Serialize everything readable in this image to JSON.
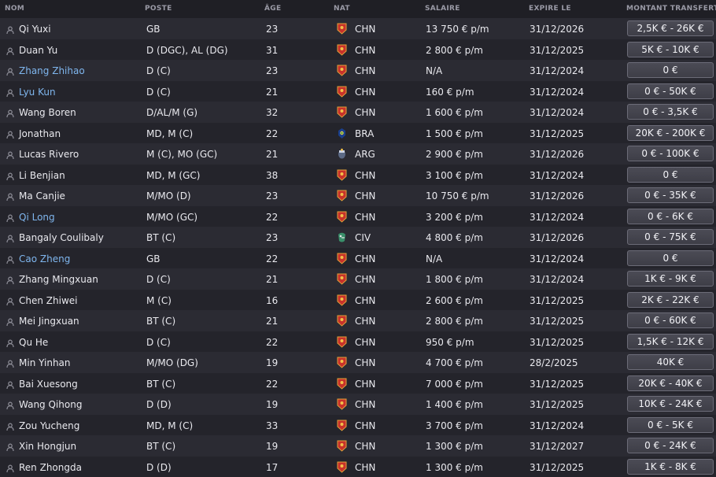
{
  "columns": {
    "name": "NOM",
    "position": "POSTE",
    "age": "ÂGE",
    "nat": "NAT",
    "salary": "SALAIRE",
    "expires": "EXPIRE LE",
    "value": "MONTANT TRANSFERT"
  },
  "colors": {
    "link_name": "#7fb6ee",
    "row_odd": "#2b2b33",
    "row_even": "#24242b",
    "flag_chn": "#c8322a",
    "flag_bra": "#1a3f8c",
    "flag_arg": "#5c6a86",
    "flag_civ": "#3a8f6a"
  },
  "players": [
    {
      "name": "Qi Yuxi",
      "linked": false,
      "position": "GB",
      "age": "23",
      "flag_icon": "china-flag-icon",
      "nat": "CHN",
      "salary": "13 750 € p/m",
      "expires": "31/12/2026",
      "value": "2,5K € - 26K €"
    },
    {
      "name": "Duan Yu",
      "linked": false,
      "position": "D (DGC), AL (DG)",
      "age": "31",
      "flag_icon": "china-flag-icon",
      "nat": "CHN",
      "salary": "2 800 € p/m",
      "expires": "31/12/2025",
      "value": "5K € - 10K €"
    },
    {
      "name": "Zhang Zhihao",
      "linked": true,
      "position": "D (C)",
      "age": "23",
      "flag_icon": "china-flag-icon",
      "nat": "CHN",
      "salary": "N/A",
      "expires": "31/12/2024",
      "value": "0 €"
    },
    {
      "name": "Lyu Kun",
      "linked": true,
      "position": "D (C)",
      "age": "21",
      "flag_icon": "china-flag-icon",
      "nat": "CHN",
      "salary": "160 € p/m",
      "expires": "31/12/2024",
      "value": "0 € - 50K €"
    },
    {
      "name": "Wang Boren",
      "linked": false,
      "position": "D/AL/M (G)",
      "age": "32",
      "flag_icon": "china-flag-icon",
      "nat": "CHN",
      "salary": "1 600 € p/m",
      "expires": "31/12/2024",
      "value": "0 € - 3,5K €"
    },
    {
      "name": "Jonathan",
      "linked": false,
      "position": "MD, M (C)",
      "age": "22",
      "flag_icon": "brazil-flag-icon",
      "nat": "BRA",
      "salary": "1 500 € p/m",
      "expires": "31/12/2025",
      "value": "20K € - 200K €"
    },
    {
      "name": "Lucas Rivero",
      "linked": false,
      "position": "M (C), MO (GC)",
      "age": "21",
      "flag_icon": "argentina-flag-icon",
      "nat": "ARG",
      "salary": "2 900 € p/m",
      "expires": "31/12/2026",
      "value": "0 € - 100K €"
    },
    {
      "name": "Li Benjian",
      "linked": false,
      "position": "MD, M (GC)",
      "age": "38",
      "flag_icon": "china-flag-icon",
      "nat": "CHN",
      "salary": "3 100 € p/m",
      "expires": "31/12/2024",
      "value": "0 €"
    },
    {
      "name": "Ma Canjie",
      "linked": false,
      "position": "M/MO (D)",
      "age": "23",
      "flag_icon": "china-flag-icon",
      "nat": "CHN",
      "salary": "10 750 € p/m",
      "expires": "31/12/2026",
      "value": "0 € - 35K €"
    },
    {
      "name": "Qi Long",
      "linked": true,
      "position": "M/MO (GC)",
      "age": "22",
      "flag_icon": "china-flag-icon",
      "nat": "CHN",
      "salary": "3 200 € p/m",
      "expires": "31/12/2024",
      "value": "0 € - 6K €"
    },
    {
      "name": "Bangaly Coulibaly",
      "linked": false,
      "position": "BT (C)",
      "age": "23",
      "flag_icon": "ivory-coast-flag-icon",
      "nat": "CIV",
      "salary": "4 800 € p/m",
      "expires": "31/12/2026",
      "value": "0 € - 75K €"
    },
    {
      "name": "Cao Zheng",
      "linked": true,
      "position": "GB",
      "age": "22",
      "flag_icon": "china-flag-icon",
      "nat": "CHN",
      "salary": "N/A",
      "expires": "31/12/2024",
      "value": "0 €"
    },
    {
      "name": "Zhang Mingxuan",
      "linked": false,
      "position": "D (C)",
      "age": "21",
      "flag_icon": "china-flag-icon",
      "nat": "CHN",
      "salary": "1 800 € p/m",
      "expires": "31/12/2024",
      "value": "1K € - 9K €"
    },
    {
      "name": "Chen Zhiwei",
      "linked": false,
      "position": "M (C)",
      "age": "16",
      "flag_icon": "china-flag-icon",
      "nat": "CHN",
      "salary": "2 600 € p/m",
      "expires": "31/12/2025",
      "value": "2K € - 22K €"
    },
    {
      "name": "Mei Jingxuan",
      "linked": false,
      "position": "BT (C)",
      "age": "21",
      "flag_icon": "china-flag-icon",
      "nat": "CHN",
      "salary": "2 800 € p/m",
      "expires": "31/12/2025",
      "value": "0 € - 60K €"
    },
    {
      "name": "Qu He",
      "linked": false,
      "position": "D (C)",
      "age": "22",
      "flag_icon": "china-flag-icon",
      "nat": "CHN",
      "salary": "950 € p/m",
      "expires": "31/12/2025",
      "value": "1,5K € - 12K €"
    },
    {
      "name": "Min Yinhan",
      "linked": false,
      "position": "M/MO (DG)",
      "age": "19",
      "flag_icon": "china-flag-icon",
      "nat": "CHN",
      "salary": "4 700 € p/m",
      "expires": "28/2/2025",
      "value": "40K €"
    },
    {
      "name": "Bai Xuesong",
      "linked": false,
      "position": "BT (C)",
      "age": "22",
      "flag_icon": "china-flag-icon",
      "nat": "CHN",
      "salary": "7 000 € p/m",
      "expires": "31/12/2025",
      "value": "20K € - 40K €"
    },
    {
      "name": "Wang Qihong",
      "linked": false,
      "position": "D (D)",
      "age": "19",
      "flag_icon": "china-flag-icon",
      "nat": "CHN",
      "salary": "1 400 € p/m",
      "expires": "31/12/2025",
      "value": "10K € - 24K €"
    },
    {
      "name": "Zou Yucheng",
      "linked": false,
      "position": "MD, M (C)",
      "age": "33",
      "flag_icon": "china-flag-icon",
      "nat": "CHN",
      "salary": "3 700 € p/m",
      "expires": "31/12/2024",
      "value": "0 € - 5K €"
    },
    {
      "name": "Xin Hongjun",
      "linked": false,
      "position": "BT (C)",
      "age": "19",
      "flag_icon": "china-flag-icon",
      "nat": "CHN",
      "salary": "1 300 € p/m",
      "expires": "31/12/2027",
      "value": "0 € - 24K €"
    },
    {
      "name": "Ren Zhongda",
      "linked": false,
      "position": "D (D)",
      "age": "17",
      "flag_icon": "china-flag-icon",
      "nat": "CHN",
      "salary": "1 300 € p/m",
      "expires": "31/12/2025",
      "value": "1K € - 8K €"
    }
  ]
}
